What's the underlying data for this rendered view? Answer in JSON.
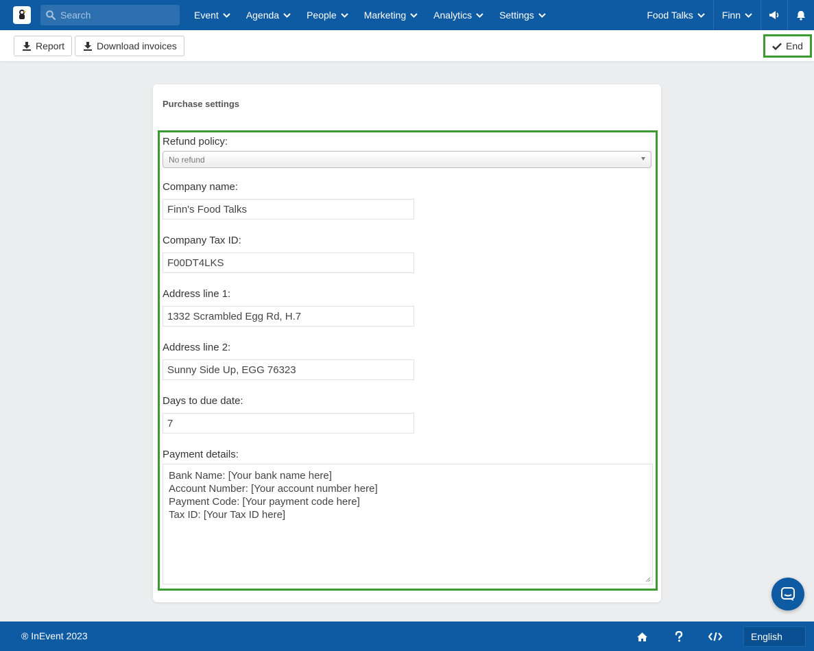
{
  "nav": {
    "search_placeholder": "Search",
    "menu": [
      "Event",
      "Agenda",
      "People",
      "Marketing",
      "Analytics",
      "Settings"
    ],
    "event_name": "Food Talks",
    "user_name": "Finn"
  },
  "toolbar": {
    "report_label": "Report",
    "download_label": "Download invoices",
    "end_label": "End"
  },
  "card": {
    "title": "Purchase settings",
    "refund_label": "Refund policy:",
    "refund_value": "No refund",
    "company_label": "Company name:",
    "company_value": "Finn's Food Talks",
    "taxid_label": "Company Tax ID:",
    "taxid_value": "F00DT4LKS",
    "address1_label": "Address line 1:",
    "address1_value": "1332 Scrambled Egg Rd, H.7",
    "address2_label": "Address line 2:",
    "address2_value": "Sunny Side Up, EGG 76323",
    "days_label": "Days to due date:",
    "days_value": "7",
    "payment_label": "Payment details:",
    "payment_lines": [
      "Bank Name: [Your bank name here]",
      "Account Number: [Your account number here]",
      "Payment Code: [Your payment code here]",
      "Tax ID: [Your Tax ID here]"
    ]
  },
  "footer": {
    "copyright": "® InEvent 2023",
    "language": "English"
  },
  "colors": {
    "brand_blue": "#0e5ba3",
    "highlight_green": "#3a9b2e",
    "page_bg": "#ebedee"
  }
}
